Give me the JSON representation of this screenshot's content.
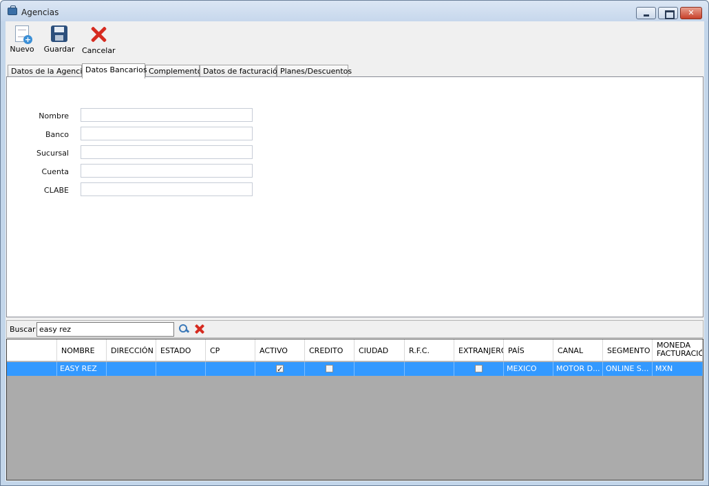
{
  "window": {
    "title": "Agencias"
  },
  "toolbar": {
    "new_label": "Nuevo",
    "save_label": "Guardar",
    "cancel_label": "Cancelar"
  },
  "tabs": [
    {
      "label": "Datos de la Agencia",
      "active": false
    },
    {
      "label": "Datos Bancarios",
      "active": true
    },
    {
      "label": "Complementos",
      "active": false
    },
    {
      "label": "Datos de facturación",
      "active": false
    },
    {
      "label": "Planes/Descuentos",
      "active": false
    }
  ],
  "form": {
    "fields": [
      {
        "label": "Nombre",
        "value": ""
      },
      {
        "label": "Banco",
        "value": ""
      },
      {
        "label": "Sucursal",
        "value": ""
      },
      {
        "label": "Cuenta",
        "value": ""
      },
      {
        "label": "CLABE",
        "value": ""
      }
    ]
  },
  "search": {
    "label": "Buscar",
    "value": "easy rez"
  },
  "grid": {
    "columns": [
      "",
      "NOMBRE",
      "DIRECCIÓN",
      "ESTADO",
      "CP",
      "ACTIVO",
      "CREDITO",
      "CIUDAD",
      "R.F.C.",
      "EXTRANJERO",
      "PAÍS",
      "CANAL",
      "SEGMENTO",
      "MONEDA FACTURACIÓN"
    ],
    "rows": [
      {
        "selected": true,
        "cells": [
          "",
          "EASY REZ",
          "",
          "",
          "",
          true,
          false,
          "",
          "",
          false,
          "MEXICO",
          "MOTOR D...",
          "ONLINE S...",
          "MXN"
        ]
      }
    ]
  }
}
